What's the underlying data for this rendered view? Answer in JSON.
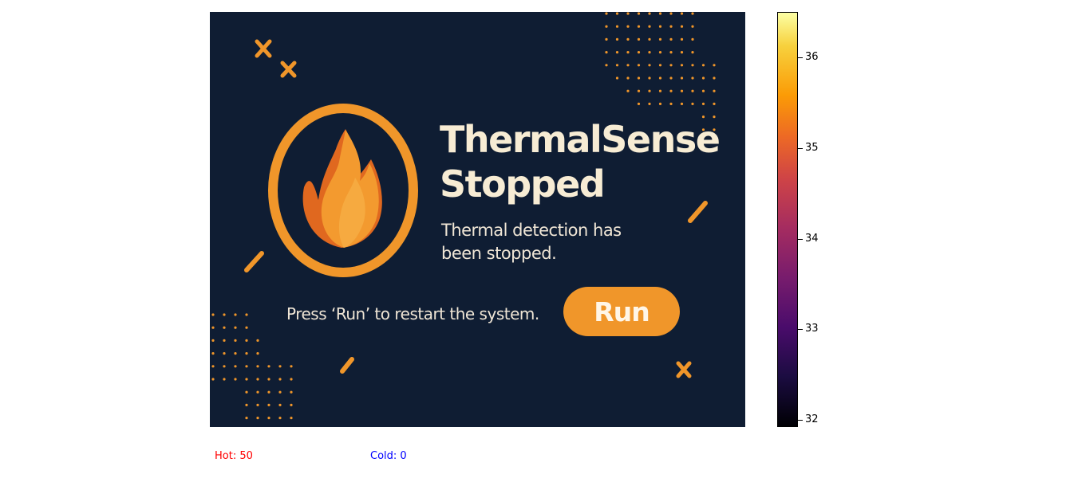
{
  "banner": {
    "title_line1": "ThermalSense",
    "title_line2": "Stopped",
    "subtitle_line1": "Thermal detection has",
    "subtitle_line2": "been stopped.",
    "prompt": "Press ‘Run’ to restart the system.",
    "run_label": "Run",
    "icon": "flame-icon",
    "colors": {
      "background": "#0f1d33",
      "accent": "#f0962a",
      "text": "#f7ecd4"
    }
  },
  "colorbar": {
    "colormap": "inferno",
    "ticks": [
      "36",
      "35",
      "34",
      "33",
      "32"
    ]
  },
  "status": {
    "hot": "Hot: 50",
    "cold": "Cold: 0",
    "hot_color": "#ff0000",
    "cold_color": "#0000ff"
  }
}
